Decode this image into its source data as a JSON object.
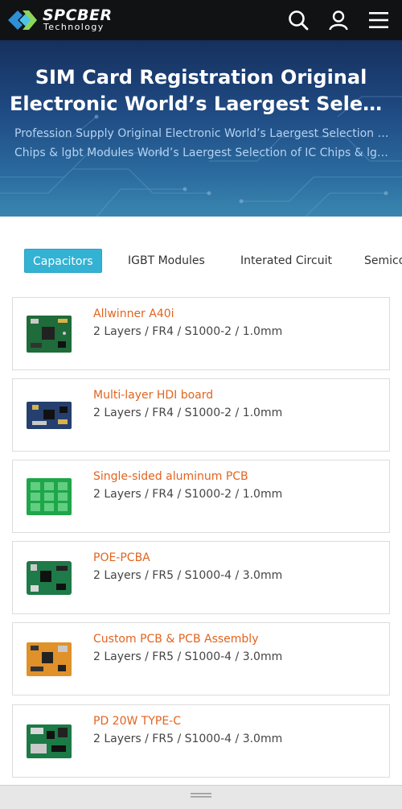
{
  "brand": {
    "name": "SPCBER",
    "tagline": "Technology",
    "colors": {
      "dark": "#111214",
      "accent": "#33b2d3",
      "title": "#e2641f"
    }
  },
  "header_icons": [
    "search-icon",
    "user-icon",
    "menu-icon"
  ],
  "hero": {
    "title_line1": "SIM Card Registration Original",
    "title_line2": "Electronic World’s Laergest Selection of IC Chips",
    "subtitle_line1": "Profession Supply Original Electronic World’s Laergest Selection of IC",
    "subtitle_line2": "Chips & lgbt Modules World’s Laergest Selection of IC Chips & lgbt Modules"
  },
  "tabs": [
    {
      "label": "Capacitors",
      "active": true
    },
    {
      "label": "IGBT Modules",
      "active": false
    },
    {
      "label": "Interated Circuit",
      "active": false
    },
    {
      "label": "Semiconductors",
      "active": false
    }
  ],
  "products": [
    {
      "title": "Allwinner A40i",
      "spec": "2 Layers / FR4 / S1000-2 / 1.0mm",
      "board_color": "#1f6b3a"
    },
    {
      "title": "Multi-layer HDI board",
      "spec": "2 Layers / FR4 / S1000-2 / 1.0mm",
      "board_color": "#25406e"
    },
    {
      "title": "Single-sided aluminum PCB",
      "spec": "2 Layers / FR4 / S1000-2 / 1.0mm",
      "board_color": "#1fa64a"
    },
    {
      "title": "POE-PCBA",
      "spec": "2 Layers / FR5 / S1000-4 / 3.0mm",
      "board_color": "#1e7a48"
    },
    {
      "title": "Custom PCB & PCB Assembly",
      "spec": "2 Layers / FR5 / S1000-4 / 3.0mm",
      "board_color": "#e0912a"
    },
    {
      "title": "PD 20W TYPE-C",
      "spec": "2 Layers / FR5 / S1000-4 / 3.0mm",
      "board_color": "#1b7a45"
    }
  ]
}
